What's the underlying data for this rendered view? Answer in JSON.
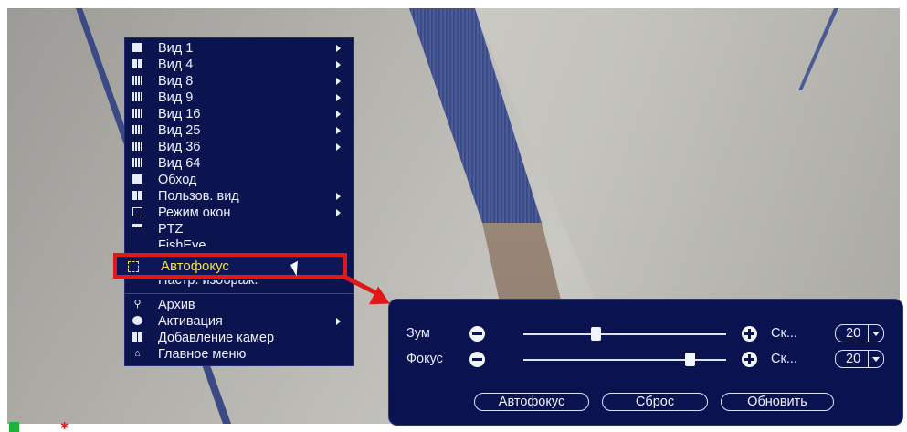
{
  "menu": {
    "items": [
      {
        "label": "Вид 1",
        "icon": "single-view-icon",
        "submenu": true
      },
      {
        "label": "Вид 4",
        "icon": "grid-4-icon",
        "submenu": true
      },
      {
        "label": "Вид 8",
        "icon": "grid-8-icon",
        "submenu": true
      },
      {
        "label": "Вид 9",
        "icon": "grid-9-icon",
        "submenu": true
      },
      {
        "label": "Вид 16",
        "icon": "grid-16-icon",
        "submenu": true
      },
      {
        "label": "Вид 25",
        "icon": "grid-25-icon",
        "submenu": true
      },
      {
        "label": "Вид 36",
        "icon": "grid-36-icon",
        "submenu": true
      },
      {
        "label": "Вид 64",
        "icon": "grid-64-icon",
        "submenu": false
      },
      {
        "label": "Обход",
        "icon": "tour-icon",
        "submenu": false
      },
      {
        "label": "Пользов. вид",
        "icon": "custom-view-icon",
        "submenu": true
      },
      {
        "label": "Режим окон",
        "icon": "window-mode-icon",
        "submenu": true
      },
      {
        "label": "PTZ",
        "icon": "ptz-icon",
        "submenu": false
      },
      {
        "label": "FishEye",
        "icon": "fisheye-icon",
        "submenu": false
      },
      {
        "label": "Автофокус",
        "icon": "autofocus-icon",
        "submenu": false,
        "selected": true
      },
      {
        "label": "Настр. изображ.",
        "icon": "image-settings-icon",
        "submenu": false
      },
      {
        "label": "Архив",
        "icon": "search-icon",
        "submenu": false
      },
      {
        "label": "Активация",
        "icon": "activation-icon",
        "submenu": true
      },
      {
        "label": "Добавление камер",
        "icon": "add-camera-icon",
        "submenu": false
      },
      {
        "label": "Главное меню",
        "icon": "home-icon",
        "submenu": false
      }
    ]
  },
  "autofocus": {
    "zoom": {
      "label": "Зум",
      "speed_label": "Ск...",
      "speed_value": "20",
      "level": 0.36
    },
    "focus": {
      "label": "Фокус",
      "speed_label": "Ск...",
      "speed_value": "20",
      "level": 0.82
    },
    "buttons": {
      "autofocus": "Автофокус",
      "reset": "Сброс",
      "refresh": "Обновить"
    }
  },
  "colors": {
    "highlight": "#e01818",
    "accent_text": "#f4e040",
    "panel_bg": "#0b1250"
  }
}
